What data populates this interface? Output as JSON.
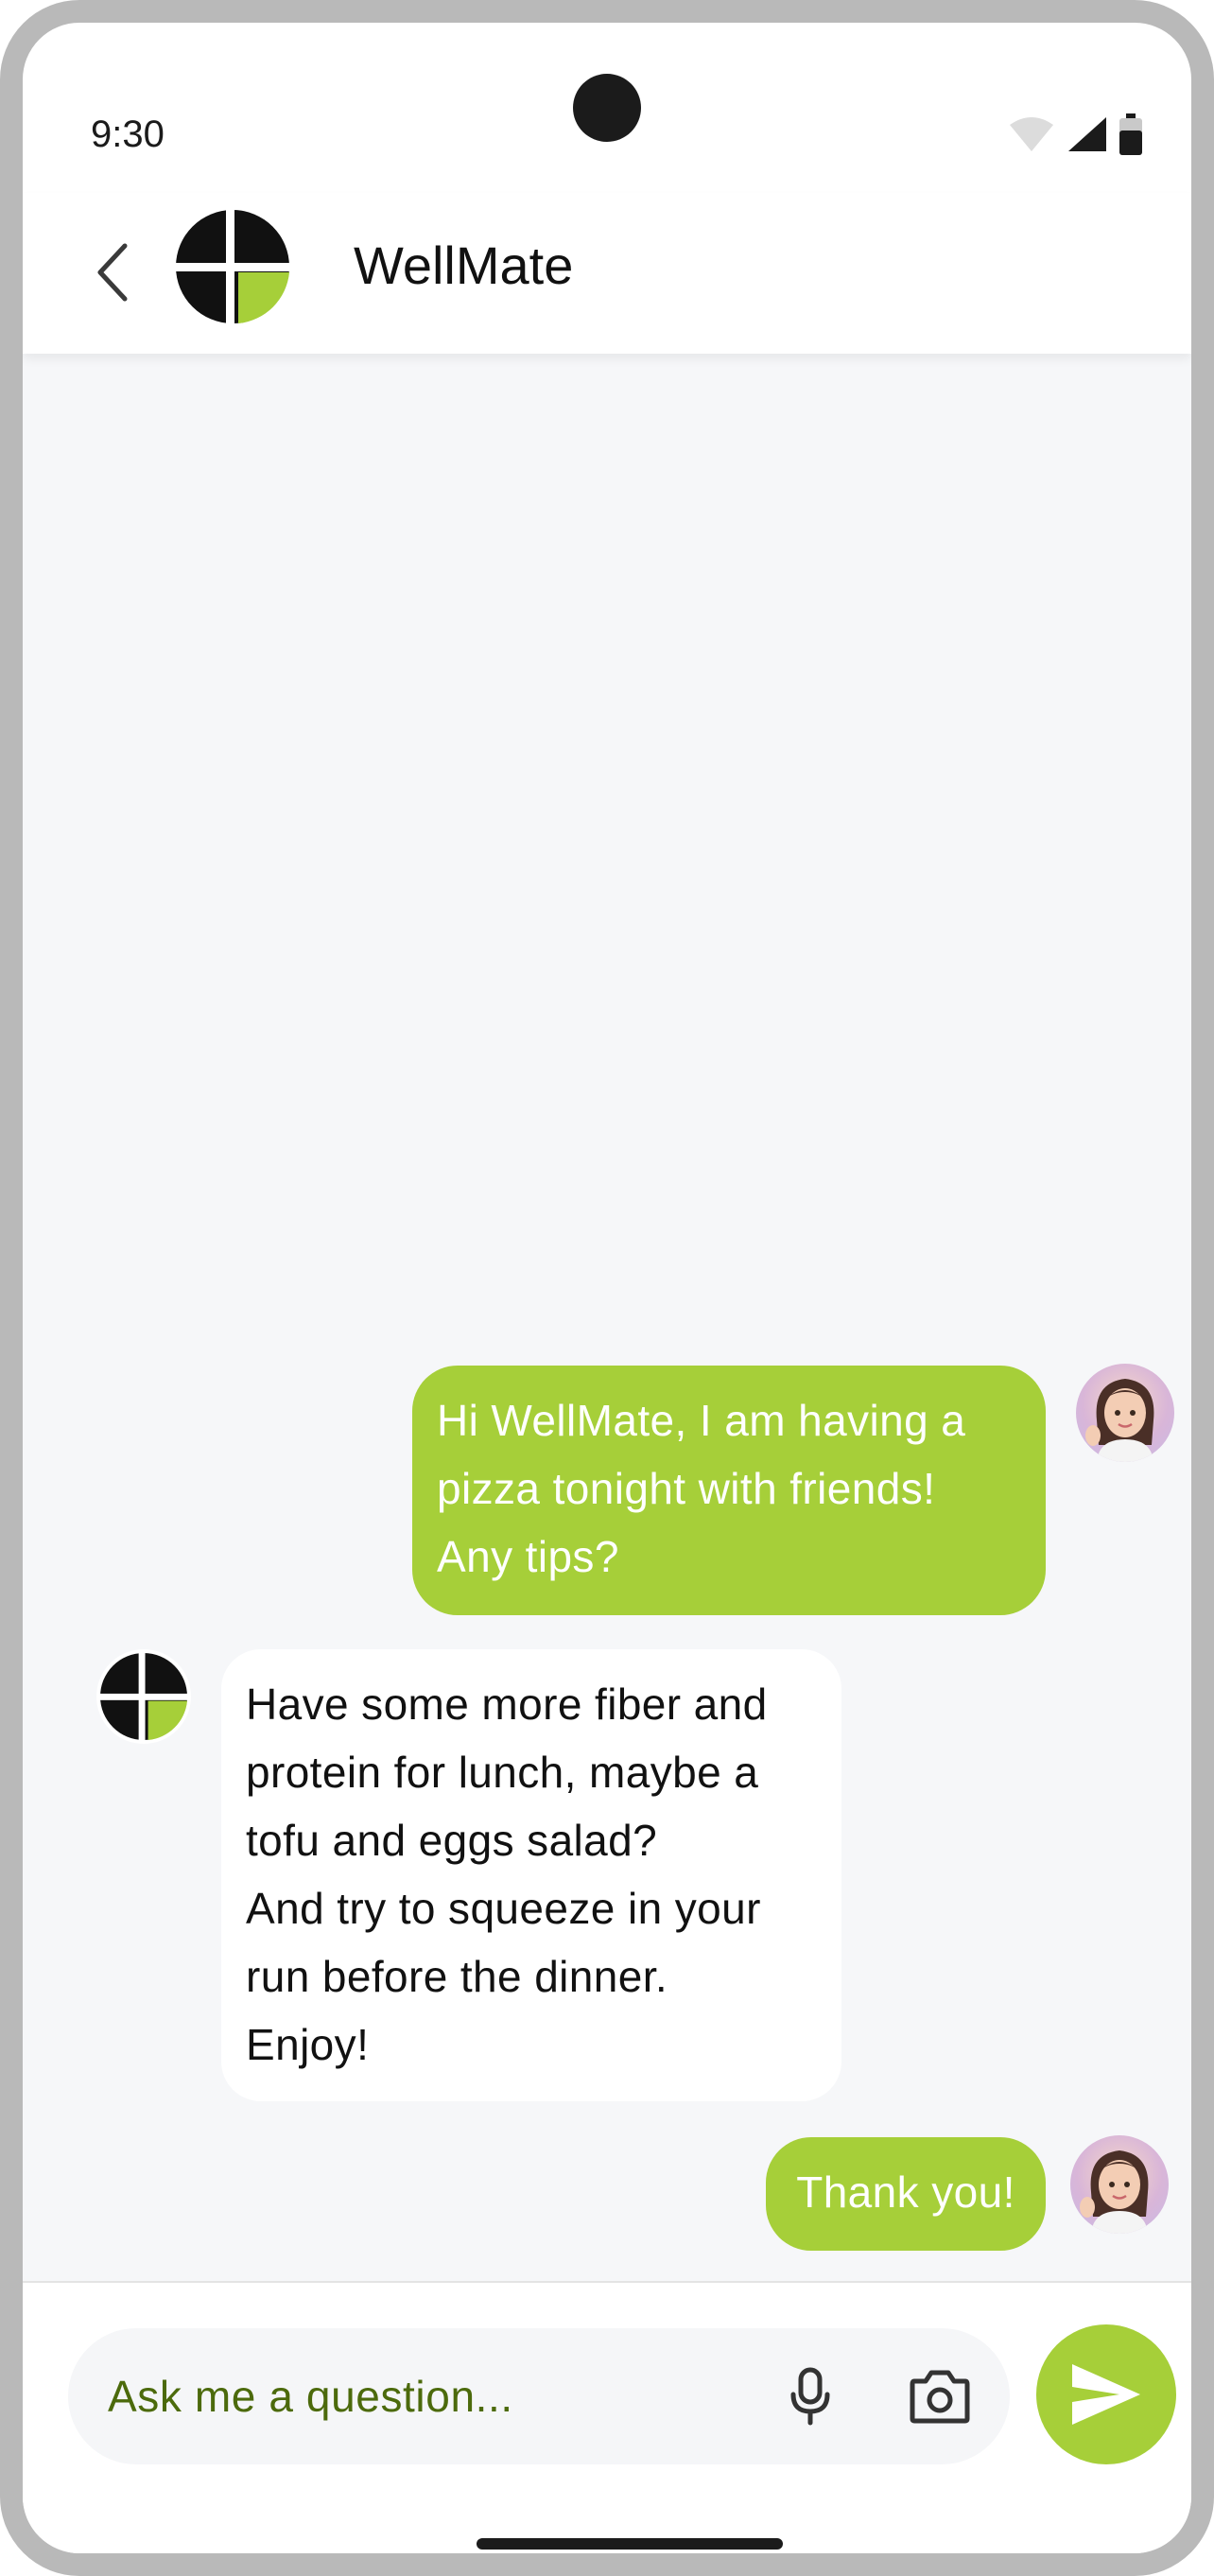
{
  "status_bar": {
    "time": "9:30"
  },
  "header": {
    "title": "WellMate",
    "logo_icon": "wellmate-logo-icon"
  },
  "colors": {
    "accent": "#a6cf39",
    "chat_bg": "#f6f7f9",
    "text_dark": "#111111"
  },
  "messages": [
    {
      "sender": "user",
      "lines": [
        "Hi WellMate, I am having a",
        "pizza tonight with friends!",
        "Any tips?"
      ]
    },
    {
      "sender": "bot",
      "lines": [
        "Have some more fiber and",
        "protein for lunch, maybe a",
        "tofu and eggs salad?",
        "And try to squeeze in your",
        "run before the dinner.",
        "Enjoy!"
      ]
    },
    {
      "sender": "user",
      "lines": [
        "Thank you!"
      ]
    }
  ],
  "input": {
    "placeholder": "Ask me a question..."
  },
  "icons": {
    "mic": "mic-icon",
    "camera": "camera-icon",
    "send": "send-icon",
    "back": "chevron-left-icon"
  }
}
